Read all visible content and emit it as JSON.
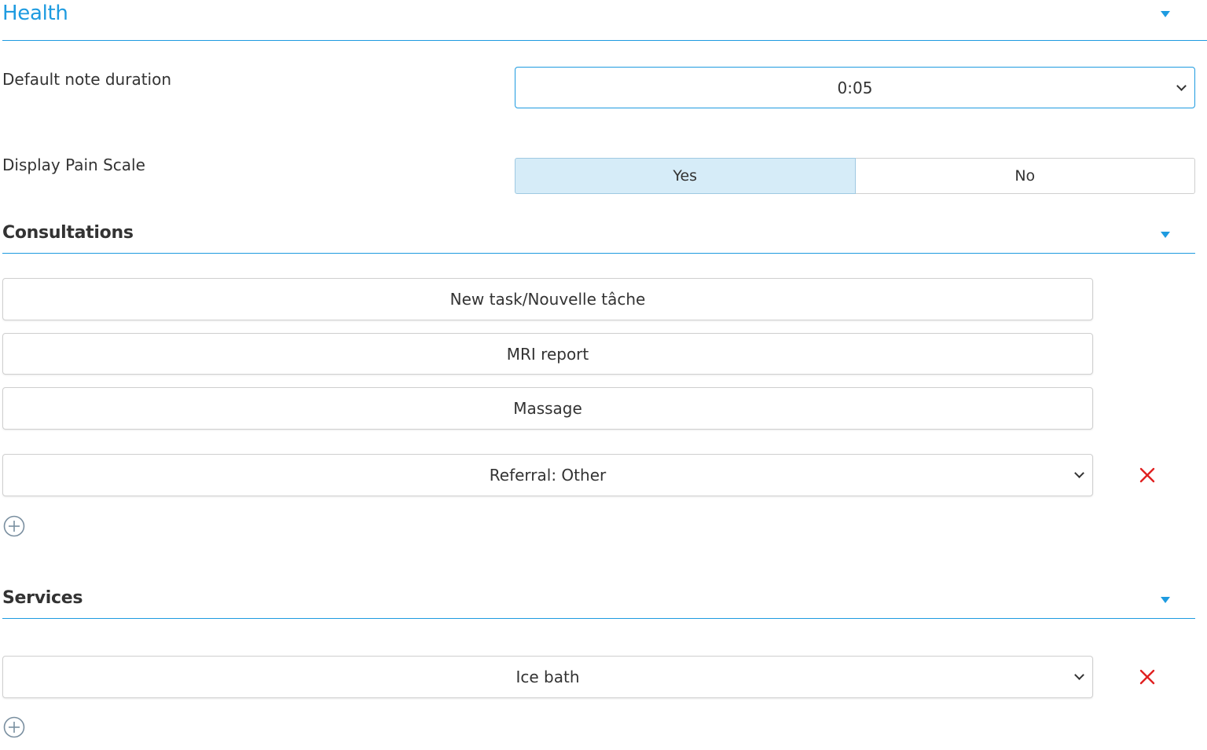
{
  "health": {
    "title": "Health",
    "default_note_duration": {
      "label": "Default note duration",
      "value": "0:05"
    },
    "display_pain_scale": {
      "label": "Display Pain Scale",
      "options": [
        "Yes",
        "No"
      ],
      "selected": "Yes"
    }
  },
  "consultations": {
    "title": "Consultations",
    "items": [
      "New task/Nouvelle tâche",
      "MRI report",
      "Massage"
    ],
    "select_value": "Referral: Other"
  },
  "services": {
    "title": "Services",
    "select_value": "Ice bath"
  },
  "colors": {
    "accent": "#1e9be0",
    "remove": "#e02020",
    "active_toggle": "#d6ecf8"
  },
  "icons": {
    "collapse": "caret-down-icon",
    "remove": "close-x-icon",
    "add": "plus-circle-icon"
  }
}
